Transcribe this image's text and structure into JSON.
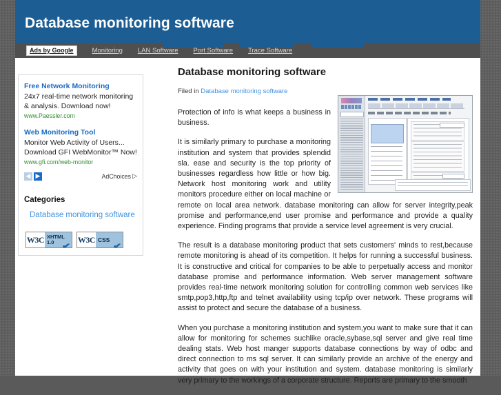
{
  "header": {
    "site_title": "Database monitoring software"
  },
  "adbar": {
    "badge_label": "Ads by Google",
    "links": [
      {
        "label": "Monitoring"
      },
      {
        "label": "LAN Software"
      },
      {
        "label": "Port Software"
      },
      {
        "label": "Trace Software"
      }
    ]
  },
  "sidebar": {
    "ads": [
      {
        "title": "Free Network Monitoring",
        "description": "24x7 real-time network monitoring & analysis. Download now!",
        "url": "www.Paessler.com"
      },
      {
        "title": "Web Monitoring Tool",
        "description": "Monitor Web Activity of Users... Download GFI WebMonitor™ Now!",
        "url": "www.gfi.com/web-monitor"
      }
    ],
    "prev_arrow": "◀",
    "next_arrow": "▶",
    "adchoices_label": "AdChoices",
    "adchoices_icon": "▷",
    "categories_heading": "Categories",
    "category_links": [
      {
        "label": "Database monitoring software"
      }
    ],
    "badges": [
      {
        "mark": "W3C",
        "line1": "XHTML",
        "line2": "1.0",
        "check": "✔"
      },
      {
        "mark": "W3C",
        "line1": "CSS",
        "line2": "",
        "check": "✔"
      }
    ]
  },
  "article": {
    "title": "Database monitoring software",
    "filed_in_label": "Filed in",
    "filed_in_link": "Database monitoring software",
    "paragraphs": [
      "Protection of info is what keeps a business in business.",
      "It is similarly primary to purchase a monitoring institution and system that provides splendid sla. ease and security is the top priority of businesses regardless how little or how big. Network host monitoring work and utility monitors procedure either on local machine or remote on local area network. database monitoring can allow for server integrity,peak promise and performance,end user promise and performance and provide a quality experience. Finding programs that provide a service level agreement is very crucial.",
      "The result is a database monitoring product that sets customers' minds to rest,because remote monitoring is ahead of its competition. It helps for running a successful business. It is constructive and critical for companies to be able to perpetually access and monitor database promise and performance information. Web server management software provides real-time network monitoring solution for controlling common web services like smtp,pop3,http,ftp and telnet availability using tcp/ip over network. These programs will assist to protect and secure the database of a business.",
      "When you purchase a monitoring institution and system,you want to make sure that it can allow for monitoring for schemes suchlike oracle,sybase,sql server and give real time dealing stats. Web host manger supports database connections by way of odbc and direct connection to ms sql server. It can similarly provide an archive of the energy and activity that goes on with your institution and system. database monitoring is similarly very primary to the workings of a corporate structure. Reports are primary to the smooth"
    ],
    "screenshot_alt": "database-administration-tool-screenshot"
  }
}
